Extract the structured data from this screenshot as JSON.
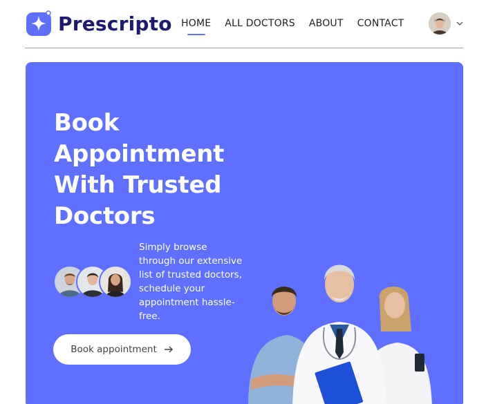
{
  "brand": {
    "name": "Prescripto",
    "logo_icon": "star-logo-icon",
    "accent": "#5f6fff",
    "logo_color": "#1e1b6e"
  },
  "nav": {
    "items": [
      {
        "label": "HOME",
        "active": true
      },
      {
        "label": "ALL DOCTORS",
        "active": false
      },
      {
        "label": "ABOUT",
        "active": false
      },
      {
        "label": "CONTACT",
        "active": false
      }
    ]
  },
  "profile": {
    "avatar_icon": "user-avatar",
    "dropdown_icon": "chevron-down-icon"
  },
  "hero": {
    "title": "Book Appointment With Trusted Doctors",
    "description": "Simply browse through our extensive list of trusted doctors, schedule your appointment hassle-free.",
    "cta_label": "Book appointment",
    "cta_icon": "arrow-right-icon",
    "background": "#5f6fff"
  }
}
